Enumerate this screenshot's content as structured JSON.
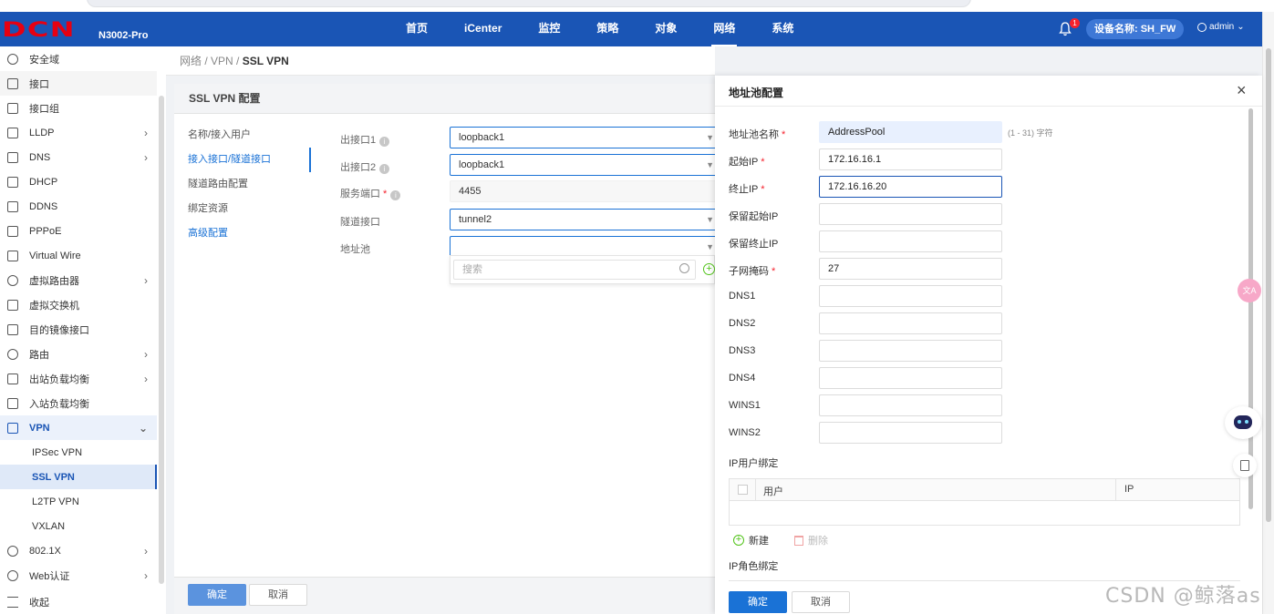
{
  "app": {
    "logo": "DCN",
    "model": "N3002-Pro",
    "nav": [
      "首页",
      "iCenter",
      "监控",
      "策略",
      "对象",
      "网络",
      "系统"
    ],
    "nav_active": "网络",
    "notifications": "1",
    "device_label": "设备名称: SH_FW",
    "user": "admin"
  },
  "sidebar": {
    "items": [
      {
        "label": "安全域",
        "icon": "shield-circle-icon"
      },
      {
        "label": "接口",
        "icon": "interface-icon"
      },
      {
        "label": "接口组",
        "icon": "interface-group-icon"
      },
      {
        "label": "LLDP",
        "icon": "lldp-icon",
        "expandable": true
      },
      {
        "label": "DNS",
        "icon": "dns-icon",
        "expandable": true
      },
      {
        "label": "DHCP",
        "icon": "dhcp-icon"
      },
      {
        "label": "DDNS",
        "icon": "ddns-icon"
      },
      {
        "label": "PPPoE",
        "icon": "pppoe-icon"
      },
      {
        "label": "Virtual Wire",
        "icon": "virtual-wire-icon"
      },
      {
        "label": "虚拟路由器",
        "icon": "virtual-router-icon",
        "expandable": true
      },
      {
        "label": "虚拟交换机",
        "icon": "virtual-switch-icon"
      },
      {
        "label": "目的镜像接口",
        "icon": "mirror-interface-icon"
      },
      {
        "label": "路由",
        "icon": "route-icon",
        "expandable": true
      },
      {
        "label": "出站负载均衡",
        "icon": "outbound-lb-icon",
        "expandable": true
      },
      {
        "label": "入站负载均衡",
        "icon": "inbound-lb-icon"
      },
      {
        "label": "VPN",
        "icon": "vpn-icon",
        "expanded": true
      },
      {
        "label": "IPSec VPN",
        "sub": true
      },
      {
        "label": "SSL VPN",
        "sub": true,
        "active": true
      },
      {
        "label": "L2TP VPN",
        "sub": true
      },
      {
        "label": "VXLAN",
        "sub": true
      },
      {
        "label": "802.1X",
        "icon": "wifi-icon",
        "expandable": true
      },
      {
        "label": "Web认证",
        "icon": "web-auth-icon",
        "expandable": true
      }
    ],
    "collapse_label": "收起"
  },
  "breadcrumb": {
    "path": "网络 / VPN / ",
    "current": "SSL VPN"
  },
  "main": {
    "title": "SSL VPN 配置",
    "steps": [
      "名称/接入用户",
      "接入接口/隧道接口",
      "隧道路由配置",
      "绑定资源",
      "高级配置"
    ],
    "active_step": "接入接口/隧道接口",
    "fields": {
      "out_if1": {
        "label": "出接口1",
        "value": "loopback1"
      },
      "out_if2": {
        "label": "出接口2",
        "value": "loopback1"
      },
      "service_port": {
        "label": "服务端口",
        "value": "4455"
      },
      "tunnel_if": {
        "label": "隧道接口",
        "value": "tunnel2"
      },
      "address_pool": {
        "label": "地址池",
        "value": ""
      }
    },
    "dropdown_search_placeholder": "搜索",
    "ok": "确定",
    "cancel": "取消"
  },
  "drawer": {
    "title": "地址池配置",
    "fields": [
      {
        "label": "地址池名称",
        "required": true,
        "value": "AddressPool",
        "hint": "(1 - 31) 字符"
      },
      {
        "label": "起始IP",
        "required": true,
        "value": "172.16.16.1"
      },
      {
        "label": "终止IP",
        "required": true,
        "value": "172.16.16.20"
      },
      {
        "label": "保留起始IP",
        "value": ""
      },
      {
        "label": "保留终止IP",
        "value": ""
      },
      {
        "label": "子网掩码",
        "required": true,
        "value": "27"
      },
      {
        "label": "DNS1",
        "value": ""
      },
      {
        "label": "DNS2",
        "value": ""
      },
      {
        "label": "DNS3",
        "value": ""
      },
      {
        "label": "DNS4",
        "value": ""
      },
      {
        "label": "WINS1",
        "value": ""
      },
      {
        "label": "WINS2",
        "value": ""
      }
    ],
    "ip_user_bind": "IP用户绑定",
    "table_cols": [
      "用户",
      "IP"
    ],
    "add_label": "新建",
    "delete_label": "删除",
    "ip_role_bind": "IP角色绑定",
    "ok": "确定",
    "cancel": "取消"
  },
  "watermark": "CSDN @鲸落as"
}
